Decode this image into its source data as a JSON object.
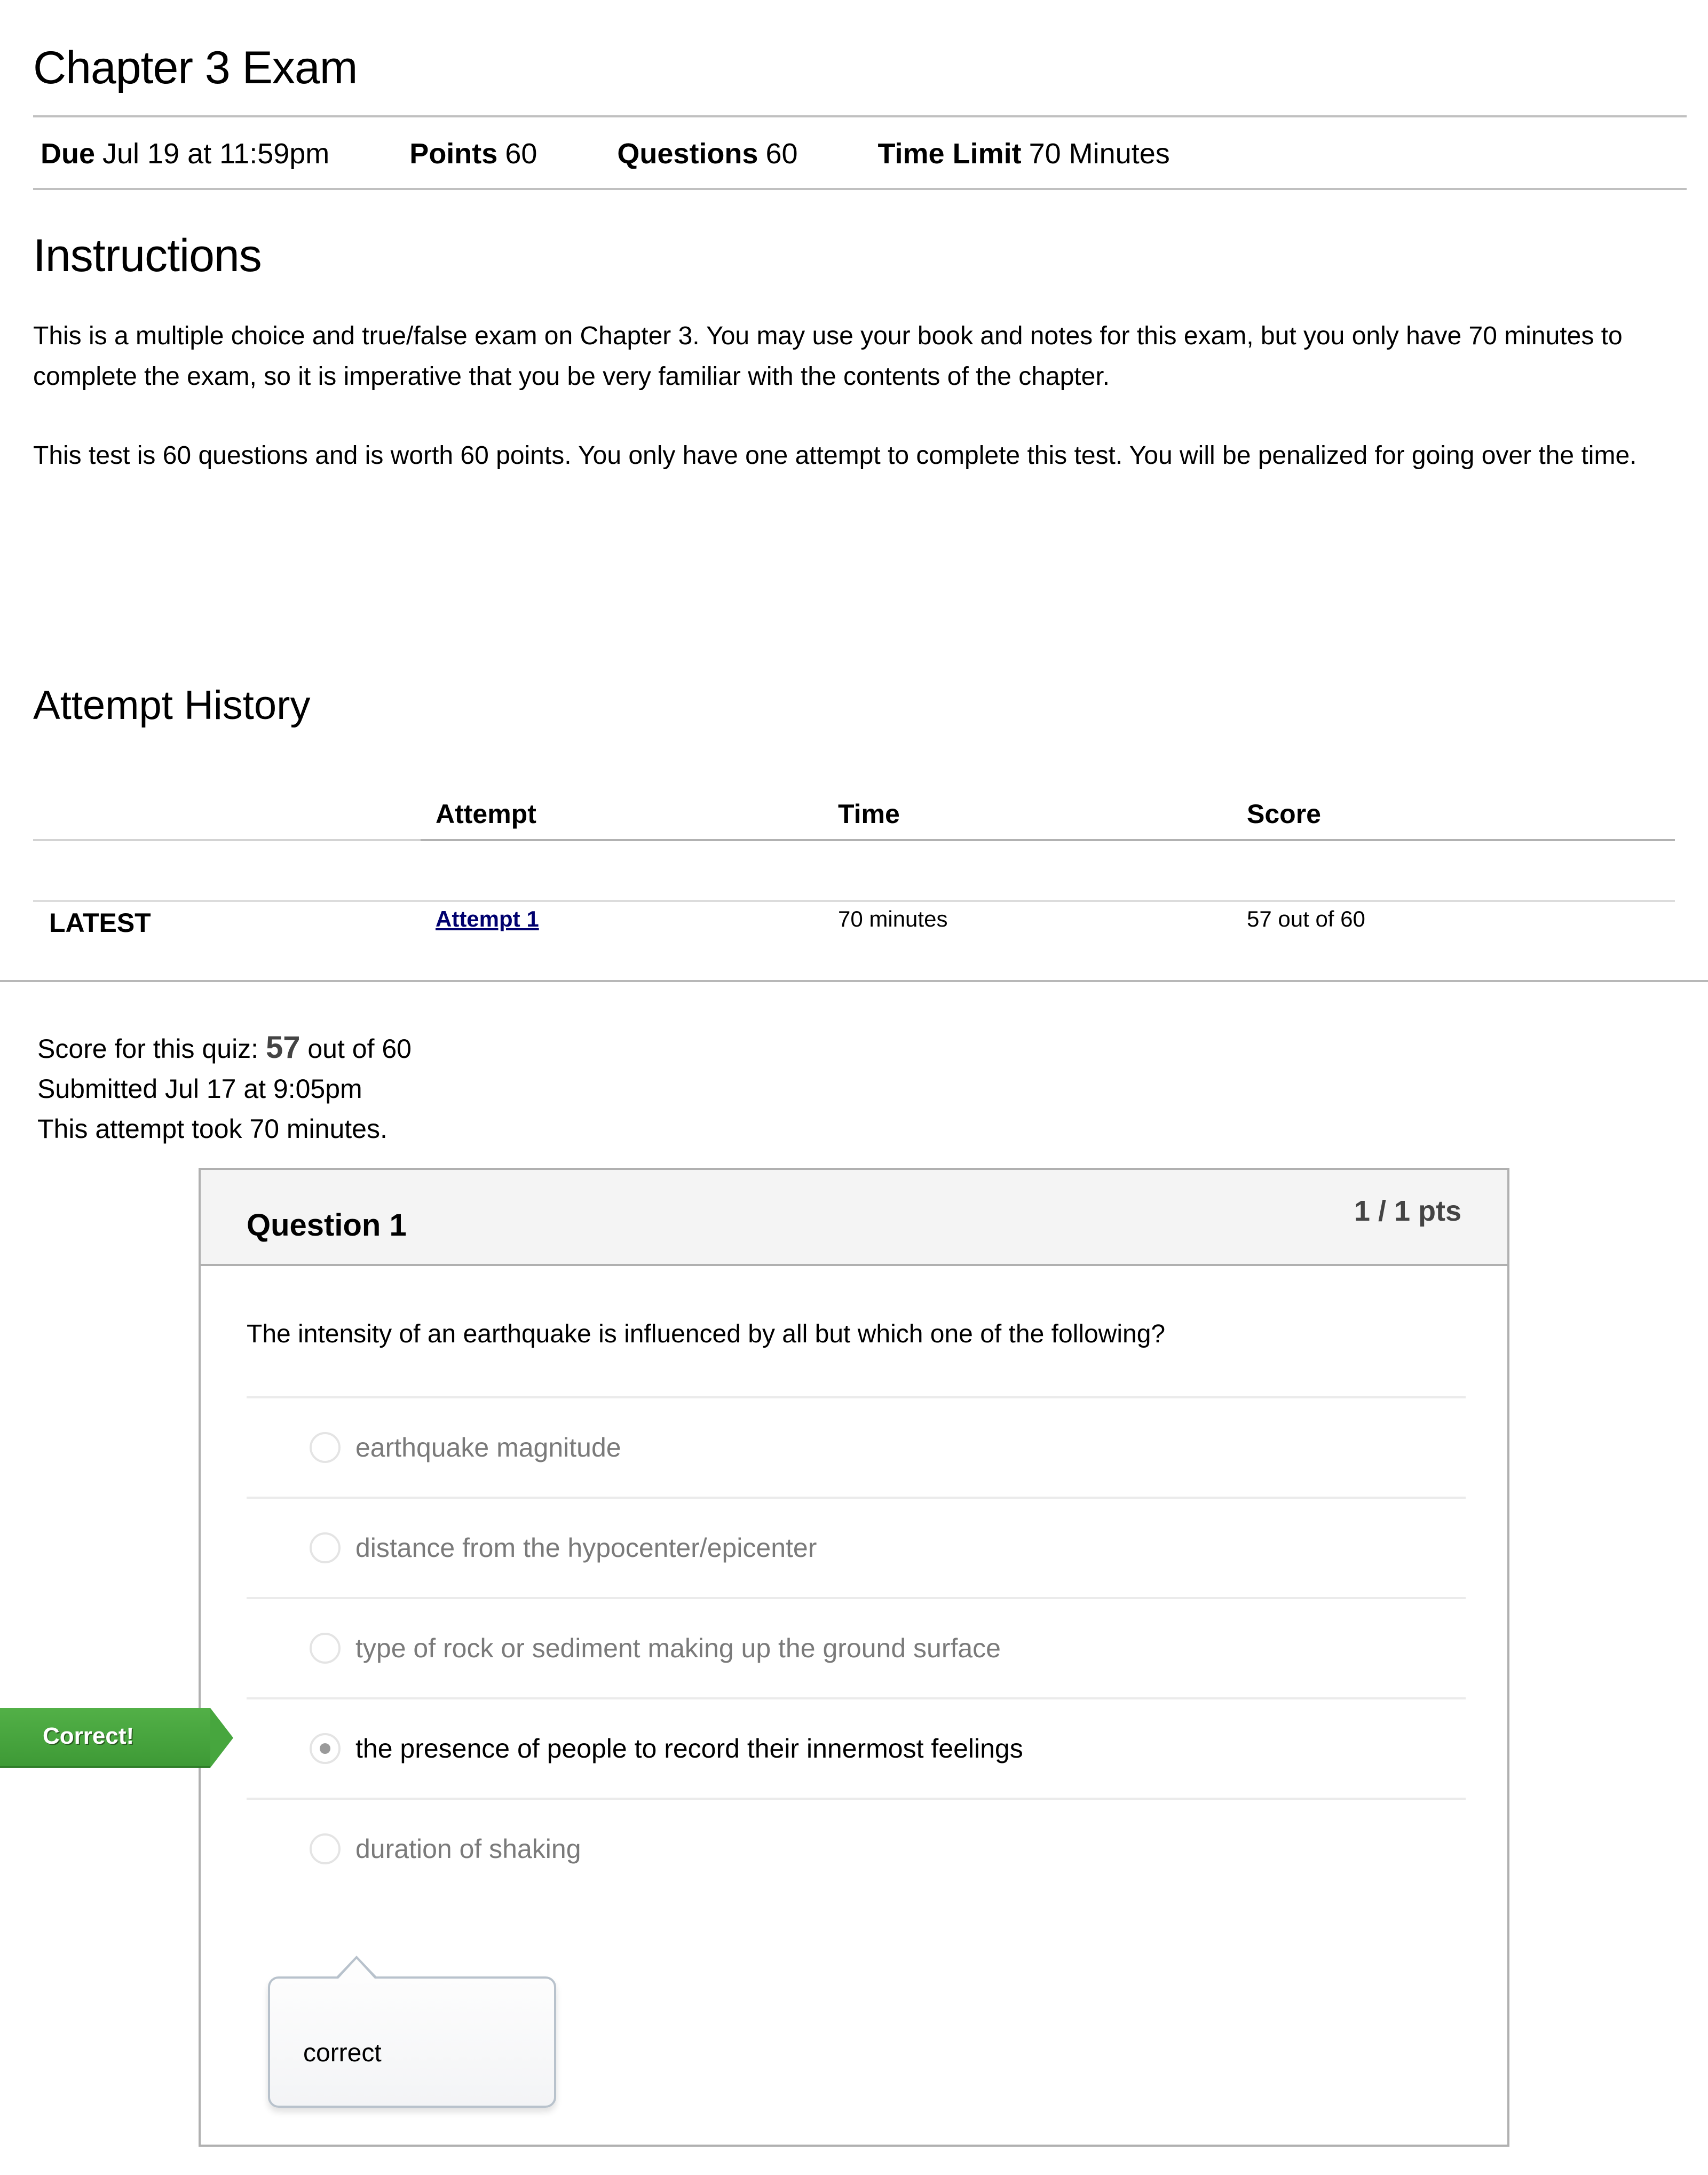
{
  "page": {
    "title": "Chapter 3 Exam"
  },
  "meta": {
    "due_label": "Due",
    "due_value": "Jul 19 at 11:59pm",
    "points_label": "Points",
    "points_value": "60",
    "questions_label": "Questions",
    "questions_value": "60",
    "time_limit_label": "Time Limit",
    "time_limit_value": "70 Minutes"
  },
  "instructions": {
    "heading": "Instructions",
    "paragraphs": [
      "This is a multiple choice and true/false exam on Chapter 3. You may use your book and notes for this exam, but you only have 70 minutes to complete the exam, so it is imperative that you be very familiar with the contents of the chapter.",
      "This test is 60 questions and is worth 60 points. You only have one attempt to complete this test. You will be penalized for going over the time."
    ]
  },
  "attempt_history": {
    "heading": "Attempt History",
    "columns": [
      "Attempt",
      "Time",
      "Score"
    ],
    "rows": [
      {
        "tag": "LATEST",
        "attempt": "Attempt 1",
        "time": "70 minutes",
        "score": "57 out of 60"
      }
    ]
  },
  "summary": {
    "score_prefix": "Score for this quiz: ",
    "score_value": "57",
    "score_suffix": " out of 60",
    "submitted": "Submitted Jul 17 at 9:05pm",
    "duration": "This attempt took 70 minutes."
  },
  "question": {
    "title": "Question 1",
    "points": "1 / 1 pts",
    "text": "The intensity of an earthquake is influenced by all but which one of the following?",
    "answers": [
      {
        "label": "earthquake magnitude",
        "selected": false
      },
      {
        "label": "distance from the hypocenter/epicenter",
        "selected": false
      },
      {
        "label": "type of rock or sediment making up the ground surface",
        "selected": false
      },
      {
        "label": "the presence of people to record their innermost feelings",
        "selected": true
      },
      {
        "label": "duration of shaking",
        "selected": false
      }
    ],
    "result_flag": "Correct!",
    "comment": "correct"
  },
  "colors": {
    "correct_green": "#47a63e",
    "link_blue": "#00006e",
    "muted_answer": "#7a7a7a"
  }
}
